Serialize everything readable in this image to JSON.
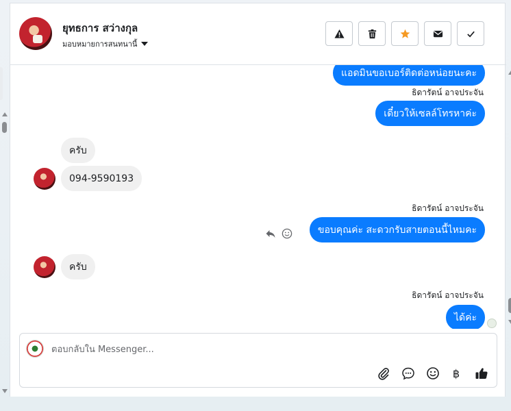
{
  "header": {
    "contact_name": "ยุทธการ สว่างกุล",
    "assign_label": "มอบหมายการสนทนานี้",
    "actions": [
      "warning-icon",
      "trash-icon",
      "star-icon",
      "envelope-icon",
      "check-icon"
    ]
  },
  "chat": {
    "messages": [
      {
        "text": "แอดมินขอเบอร์ติดต่อหน่อยนะคะ",
        "from": "page"
      },
      {
        "sender": "ธิดารัตน์ อาจประจัน"
      },
      {
        "text": "เดี๋ยวให้เซลล์โทรหาค่ะ",
        "from": "page"
      },
      {
        "text": "ครับ",
        "from": "customer"
      },
      {
        "text": "094-9590193",
        "from": "customer"
      },
      {
        "sender": "ธิดารัตน์ อาจประจัน"
      },
      {
        "text": "ขอบคุณค่ะ สะดวกรับสายตอนนี้ไหมคะ",
        "from": "page"
      },
      {
        "text": "ครับ",
        "from": "customer"
      },
      {
        "sender": "ธิดารัตน์ อาจประจัน"
      },
      {
        "text": "ได้ค่ะ",
        "from": "page"
      }
    ]
  },
  "composer": {
    "placeholder": "ตอบกลับใน Messenger...",
    "tools": [
      "paperclip-icon",
      "chat-bubble-icon",
      "emoji-icon",
      "baht-icon",
      "thumbs-up-icon"
    ]
  },
  "colors": {
    "outgoing_bubble": "#0a7cff",
    "incoming_bubble": "#f0f0f0",
    "star": "#f59a23"
  }
}
